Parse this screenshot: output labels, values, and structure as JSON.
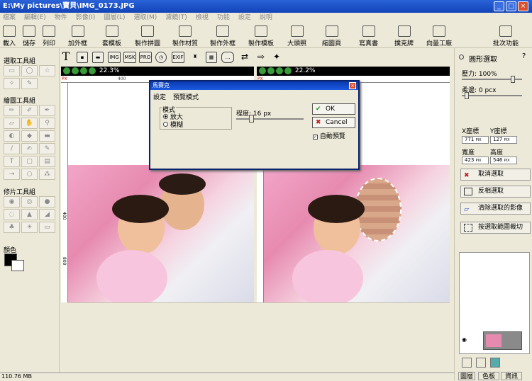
{
  "window": {
    "title": "E:\\My pictures\\寶貝\\IMG_0173.JPG"
  },
  "menu": [
    "檔案",
    "編輯(E)",
    "物件",
    "影像(I)",
    "圖層(L)",
    "選取(M)",
    "濾鏡(T)",
    "檢視",
    "功能",
    "設定",
    "說明"
  ],
  "toolbar": [
    "載入",
    "儲存",
    "列印",
    "加外框",
    "套模板",
    "製作拼圖",
    "製作材質",
    "製作外框",
    "製作模板",
    "大頭照",
    "縮圖頁",
    "寫真書",
    "撲克牌",
    "向量工廠",
    "批次功能"
  ],
  "left_panel": {
    "select_title": "選取工具組",
    "draw_title": "繪圖工具組",
    "retouch_title": "修片工具組",
    "color_title": "顏色"
  },
  "canvas": {
    "left_zoom": "22.3%",
    "right_zoom": "22.2%",
    "ruler_marks": [
      "400",
      "800"
    ],
    "px_label": "PX"
  },
  "dialog": {
    "title": "馬賽克",
    "menu": [
      "設定",
      "預覽模式"
    ],
    "group_label": "模式",
    "options": [
      "放大",
      "模糊"
    ],
    "selected_option": "放大",
    "degree_label": "程度: 16 px",
    "ok_label": "OK",
    "cancel_label": "Cancel",
    "auto_preview_label": "自動預覽",
    "auto_preview_checked": true
  },
  "right_panel": {
    "title": "圓形選取",
    "pressure": "壓力: 100%",
    "softness": "柔邊: 0 pcx",
    "x_label": "X座標",
    "y_label": "Y座標",
    "x_val": "771",
    "y_val": "127",
    "w_label": "寬度",
    "h_label": "高度",
    "w_val": "423",
    "h_val": "546",
    "unit": "PIX",
    "buttons": [
      "取消選取",
      "反相選取",
      "清除選取的影像",
      "按選取範圍裁切"
    ]
  },
  "status": {
    "memory": "110.76 MB"
  },
  "bottom_tabs": [
    "圖層",
    "色板",
    "資訊"
  ]
}
